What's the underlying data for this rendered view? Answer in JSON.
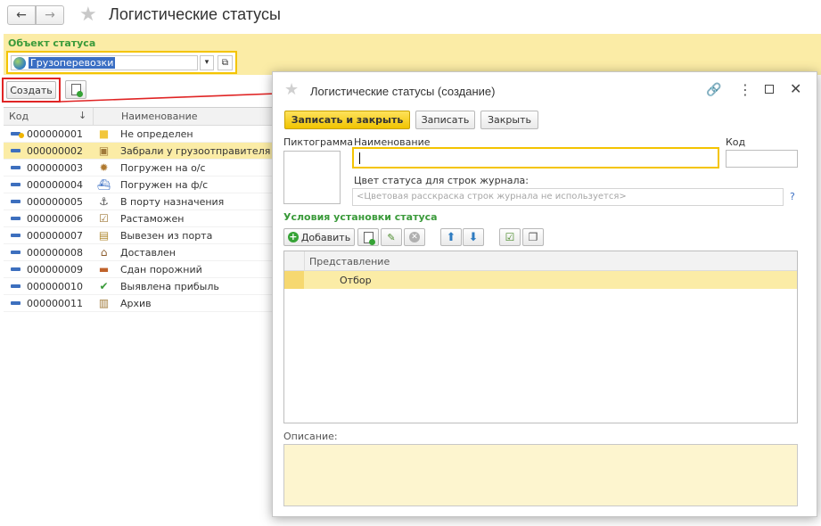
{
  "window": {
    "title": "Логистические статусы"
  },
  "status_object": {
    "label": "Объект статуса",
    "value": "Грузоперевозки",
    "dropdown_glyph": "▾",
    "open_glyph": "⧉"
  },
  "toolbar": {
    "create_label": "Создать"
  },
  "list": {
    "columns": {
      "code": "Код",
      "sort_glyph": "↓",
      "name": "Наименование"
    },
    "rows": [
      {
        "code": "000000001",
        "name": "Не определен",
        "icon": "note-icon"
      },
      {
        "code": "000000002",
        "name": "Забрали у грузоотправителя",
        "icon": "box-icon"
      },
      {
        "code": "000000003",
        "name": "Погружен на о/с",
        "icon": "gear-icon"
      },
      {
        "code": "000000004",
        "name": "Погружен на ф/с",
        "icon": "ship-icon"
      },
      {
        "code": "000000005",
        "name": "В порту назначения",
        "icon": "anchor-icon"
      },
      {
        "code": "000000006",
        "name": "Растаможен",
        "icon": "checklist-icon"
      },
      {
        "code": "000000007",
        "name": "Вывезен из порта",
        "icon": "truck-icon"
      },
      {
        "code": "000000008",
        "name": "Доставлен",
        "icon": "house-icon"
      },
      {
        "code": "000000009",
        "name": "Сдан порожний",
        "icon": "container-icon"
      },
      {
        "code": "000000010",
        "name": "Выявлена прибыль",
        "icon": "checkmark-icon"
      },
      {
        "code": "000000011",
        "name": "Архив",
        "icon": "archive-icon"
      }
    ]
  },
  "modal": {
    "title": "Логистические статусы (создание)",
    "buttons": {
      "save_close": "Записать и закрыть",
      "save": "Записать",
      "close": "Закрыть"
    },
    "labels": {
      "pictogram": "Пиктограмма",
      "name": "Наименование",
      "code": "Код",
      "color": "Цвет статуса для строк журнала:",
      "color_placeholder": "<Цветовая расскраска строк журнала не используется>",
      "help": "?",
      "conditions": "Условия установки статуса",
      "add": "Добавить",
      "description": "Описание:"
    },
    "conditions_table": {
      "column": "Представление",
      "rows": [
        "Отбор"
      ]
    }
  },
  "colors": {
    "accent_yellow": "#fbeca6",
    "focus_yellow": "#f4c400",
    "highlight_red": "#e02424",
    "green_label": "#3a9a3a"
  }
}
